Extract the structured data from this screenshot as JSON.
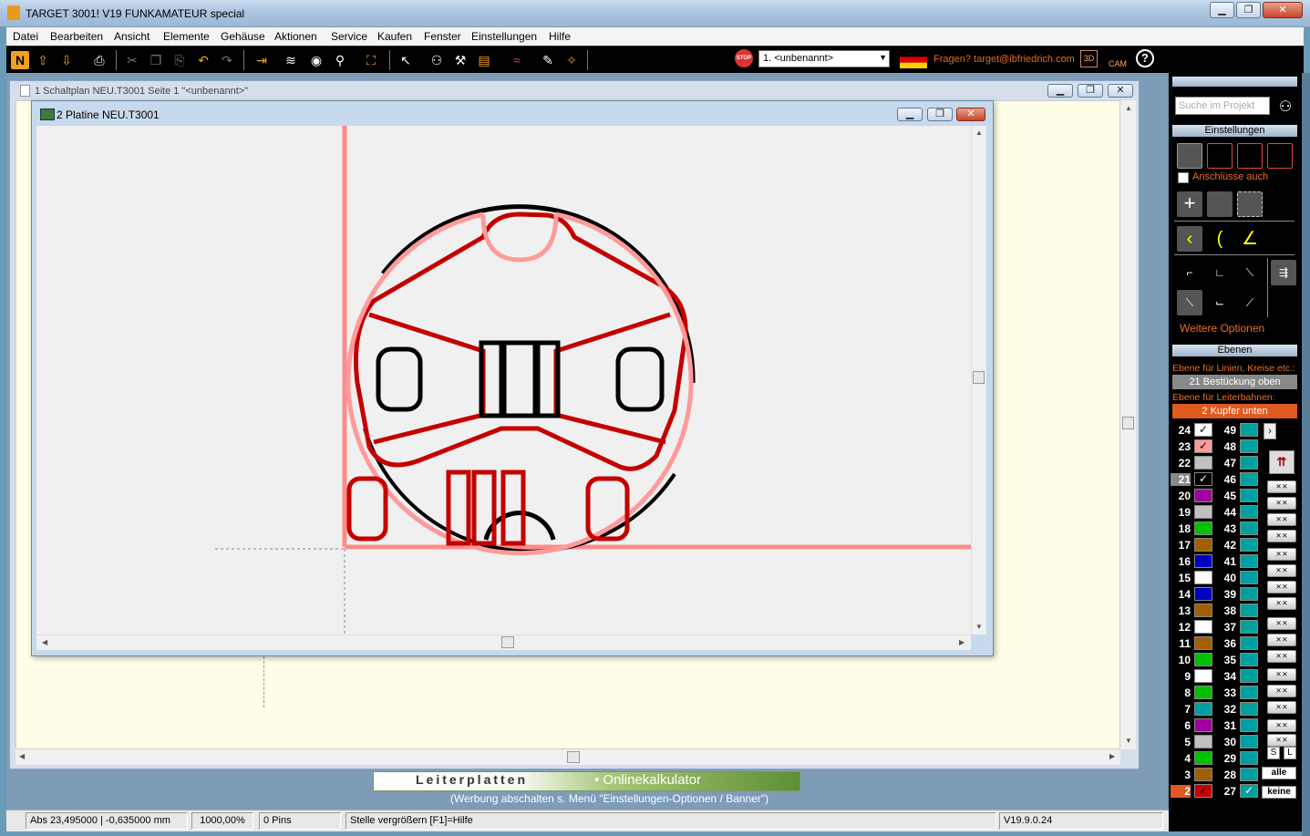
{
  "window": {
    "title": "TARGET 3001! V19 FUNKAMATEUR special",
    "minimize": "▁",
    "restore": "❐",
    "close": "✕"
  },
  "menu": [
    "Datei",
    "Bearbeiten",
    "Ansicht",
    "Elemente",
    "Gehäuse",
    "Aktionen",
    "Service",
    "Kaufen",
    "Fenster",
    "Einstellungen",
    "Hilfe"
  ],
  "toolbar": {
    "stop_label": "STOP",
    "project_select": "1. <unbenannt>",
    "help_link": "Fragen? target@ibfriedrich.com",
    "btn_3d": "3D",
    "btn_cam": "CAM",
    "btn_help": "?"
  },
  "schematic": {
    "title": "1 Schaltplan NEU.T3001 Seite 1 \"<unbenannt>\""
  },
  "pcb": {
    "title": "2 Platine NEU.T3001"
  },
  "banner": {
    "left": "Leiterplatten",
    "right": "• Onlinekalkulator",
    "note": "(Werbung abschalten s. Menü \"Einstellungen-Optionen / Banner\")"
  },
  "status": {
    "coords": "Abs 23,495000 | -0,635000 mm",
    "zoom": "1000,00%",
    "pins": "0 Pins",
    "hint": "Stelle vergrößern   [F1]=Hilfe",
    "version": "V19.9.0.24"
  },
  "panel": {
    "search_placeholder": "Suche im Projekt",
    "settings_header": "Einstellungen",
    "connections_label": "Anschlüsse auch",
    "more_options": "Weitere Optionen",
    "layers_header": "Ebenen",
    "layer_lines_label": "Ebene für Linien, Kreise etc.:",
    "layer_lines_value": "21 Bestückung oben",
    "layer_tracks_label": "Ebene für Leiterbahnen:",
    "layer_tracks_value": "2 Kupfer unten",
    "btn_all": "alle",
    "btn_none": "keine",
    "btn_s": "S",
    "btn_l": "L",
    "layers_left": [
      {
        "num": "24",
        "color": "#ffffff",
        "check": "✓"
      },
      {
        "num": "23",
        "color": "#ff9a9a",
        "check": "✓"
      },
      {
        "num": "22",
        "color": "#c0c0c0",
        "check": ""
      },
      {
        "num": "21",
        "color": "#000000",
        "check": "✓"
      },
      {
        "num": "20",
        "color": "#a000a0",
        "check": ""
      },
      {
        "num": "19",
        "color": "#c0c0c0",
        "check": ""
      },
      {
        "num": "18",
        "color": "#00c000",
        "check": ""
      },
      {
        "num": "17",
        "color": "#a06000",
        "check": ""
      },
      {
        "num": "16",
        "color": "#0000c0",
        "check": ""
      },
      {
        "num": "15",
        "color": "#ffffff",
        "check": ""
      },
      {
        "num": "14",
        "color": "#0000c0",
        "check": ""
      },
      {
        "num": "13",
        "color": "#a06000",
        "check": ""
      },
      {
        "num": "12",
        "color": "#ffffff",
        "check": ""
      },
      {
        "num": "11",
        "color": "#a06000",
        "check": ""
      },
      {
        "num": "10",
        "color": "#00c000",
        "check": ""
      },
      {
        "num": "9",
        "color": "#ffffff",
        "check": ""
      },
      {
        "num": "8",
        "color": "#00c000",
        "check": ""
      },
      {
        "num": "7",
        "color": "#00a0a0",
        "check": ""
      },
      {
        "num": "6",
        "color": "#a000a0",
        "check": ""
      },
      {
        "num": "5",
        "color": "#c0c0c0",
        "check": ""
      },
      {
        "num": "4",
        "color": "#00c000",
        "check": ""
      },
      {
        "num": "3",
        "color": "#a06000",
        "check": ""
      },
      {
        "num": "2",
        "color": "#cc0000",
        "check": "✓"
      }
    ],
    "layers_right": [
      "49",
      "48",
      "47",
      "46",
      "45",
      "44",
      "43",
      "42",
      "41",
      "40",
      "39",
      "38",
      "37",
      "36",
      "35",
      "34",
      "33",
      "32",
      "31",
      "30",
      "29",
      "28",
      "27"
    ],
    "last_right_check": "✓"
  }
}
